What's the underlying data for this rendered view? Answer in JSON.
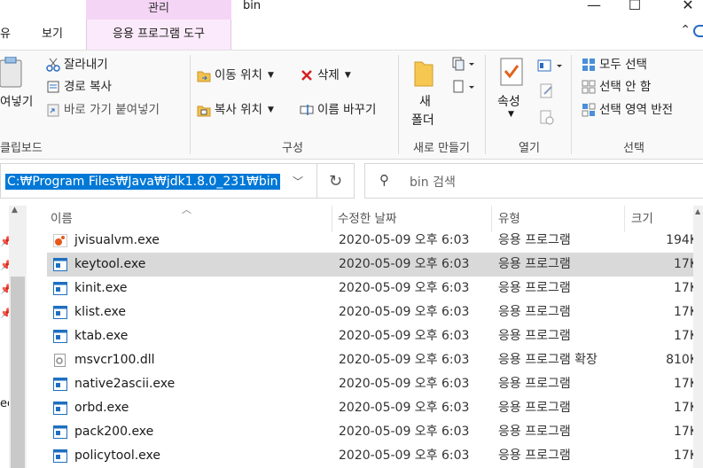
{
  "titlebar": {
    "context_group": "관리",
    "context_tab": "응용 프로그램 도구",
    "tabs": [
      "유",
      "보기"
    ],
    "window_title": "bin",
    "minimize": "—",
    "maximize": "☐",
    "close": "✕"
  },
  "ribbon": {
    "clipboard": {
      "paste_label": "여넣기",
      "cut": "잘라내기",
      "copy_path": "경로 복사",
      "paste_shortcut": "바로 가기 붙여넣기",
      "group": "클립보드"
    },
    "organize": {
      "move_to": "이동 위치",
      "delete": "삭제",
      "copy_to": "복사 위치",
      "rename": "이름 바꾸기",
      "group": "구성"
    },
    "new": {
      "new_folder_line1": "새",
      "new_folder_line2": "폴더",
      "group": "새로 만들기"
    },
    "open": {
      "properties": "속성",
      "group": "열기"
    },
    "select": {
      "select_all": "모두 선택",
      "select_none": "선택 안 함",
      "invert": "선택 영역 반전",
      "group": "선택"
    }
  },
  "address": {
    "path": "C:₩Program Files₩Java₩jdk1.8.0_231₩bin",
    "search_placeholder": "bin 검색"
  },
  "nav": {
    "partial_text": "ec"
  },
  "columns": {
    "name": "이름",
    "date": "수정한 날짜",
    "type": "유형",
    "size": "크기"
  },
  "files": [
    {
      "name": "jvisualvm.exe",
      "date": "2020-05-09 오후 6:03",
      "type": "응용 프로그램",
      "size": "194K",
      "icon": "jvisualvm-icon"
    },
    {
      "name": "keytool.exe",
      "date": "2020-05-09 오후 6:03",
      "type": "응용 프로그램",
      "size": "17K",
      "icon": "exe-icon",
      "selected": true
    },
    {
      "name": "kinit.exe",
      "date": "2020-05-09 오후 6:03",
      "type": "응용 프로그램",
      "size": "17K",
      "icon": "exe-icon"
    },
    {
      "name": "klist.exe",
      "date": "2020-05-09 오후 6:03",
      "type": "응용 프로그램",
      "size": "17K",
      "icon": "exe-icon"
    },
    {
      "name": "ktab.exe",
      "date": "2020-05-09 오후 6:03",
      "type": "응용 프로그램",
      "size": "17K",
      "icon": "exe-icon"
    },
    {
      "name": "msvcr100.dll",
      "date": "2020-05-09 오후 6:03",
      "type": "응용 프로그램 확장",
      "size": "810K",
      "icon": "dll-icon"
    },
    {
      "name": "native2ascii.exe",
      "date": "2020-05-09 오후 6:03",
      "type": "응용 프로그램",
      "size": "17K",
      "icon": "exe-icon"
    },
    {
      "name": "orbd.exe",
      "date": "2020-05-09 오후 6:03",
      "type": "응용 프로그램",
      "size": "17K",
      "icon": "exe-icon"
    },
    {
      "name": "pack200.exe",
      "date": "2020-05-09 오후 6:03",
      "type": "응용 프로그램",
      "size": "17K",
      "icon": "exe-icon"
    },
    {
      "name": "policytool.exe",
      "date": "2020-05-09 오후 6:03",
      "type": "응용 프로그램",
      "size": "17K",
      "icon": "exe-icon"
    }
  ],
  "colors": {
    "selection": "#0078d7",
    "context_tab": "#f5d5f6",
    "row_selected": "#d9d9d9",
    "exe_icon": "#1e6fc0"
  }
}
